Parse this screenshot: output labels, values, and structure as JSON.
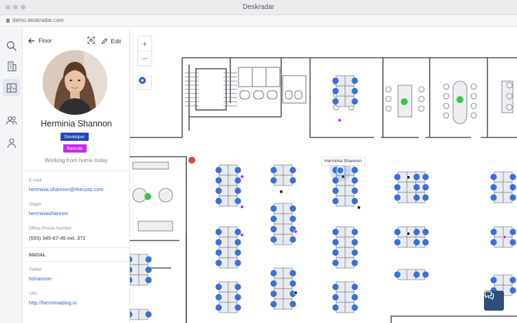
{
  "window": {
    "title": "Deskradar",
    "url": "demo.deskradar.com"
  },
  "rail": {
    "items": [
      {
        "name": "search-icon"
      },
      {
        "name": "building-icon"
      },
      {
        "name": "floorplan-icon",
        "active": true
      },
      {
        "name": "people-icon"
      },
      {
        "name": "person-icon"
      }
    ]
  },
  "panel": {
    "back_label": "Floor",
    "edit_label": "Edit",
    "person": {
      "name": "Herminia Shannon",
      "badges": [
        {
          "label": "Developer",
          "color": "#2347b8"
        },
        {
          "label": "Remote",
          "color": "#c62cf0"
        }
      ],
      "status": "Working from home today"
    },
    "fields": {
      "email_label": "E-mail",
      "email": "herminia.shannon@thecorp.com",
      "skype_label": "Skype",
      "skype": "herminiashannon",
      "phone_label": "Office Phone Number",
      "phone": "(555) 345-67-45 ext. 372"
    },
    "social": {
      "heading": "SOCIAL",
      "twitter_label": "Twitter",
      "twitter": "hshannon",
      "url_label": "URL",
      "url": "http://herminiablog.io"
    }
  },
  "map": {
    "zoom_in": "+",
    "zoom_out": "−",
    "tooltip": "Herminia Shannon"
  },
  "colors": {
    "seat": "#3c6fd8",
    "accent_green": "#3cc24b",
    "alert_red": "#e0473a",
    "chat_button": "#2e4f7c"
  }
}
